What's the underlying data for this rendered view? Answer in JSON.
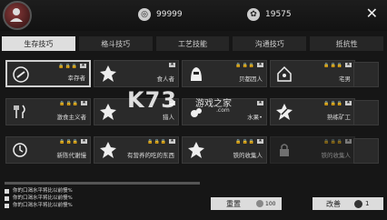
{
  "currency": {
    "coins": "99999",
    "points": "19575"
  },
  "tabs": [
    "生存技巧",
    "格斗技巧",
    "工艺技能",
    "沟通技巧",
    "抵抗性"
  ],
  "active_tab": 0,
  "perks": [
    {
      "name": "幸存者",
      "icon": "survivor-icon"
    },
    {
      "name": "食人者",
      "icon": "cannibal-icon"
    },
    {
      "name": "贝都因人",
      "icon": "bedouin-icon"
    },
    {
      "name": "宅男",
      "icon": "house-icon"
    },
    {
      "name": "激食主义者",
      "icon": "eater-icon"
    },
    {
      "name": "猎人",
      "icon": "hunter-icon"
    },
    {
      "name": "水果•",
      "icon": "fruit-icon"
    },
    {
      "name": "熟练矿工",
      "icon": "miner-icon"
    },
    {
      "name": "新陈代谢慢",
      "icon": "metabolism-icon"
    },
    {
      "name": "有营养的吃的东西",
      "icon": "nutrition-icon"
    },
    {
      "name": "铁的收集人",
      "icon": "iron-collector-icon"
    },
    {
      "name": "铁的收集人",
      "icon": "locked-icon"
    }
  ],
  "messages": [
    "你的口渴水平将比以前慢%",
    "你的口渴水平将比以前慢%",
    "你的口渴水平将比以前慢%"
  ],
  "buttons": {
    "reset": "重置",
    "reset_cost": "100",
    "modify": "改善",
    "modify_count": "1"
  },
  "watermark": {
    "main": "K73",
    "sub": "游戏之家",
    "url": ".com"
  }
}
